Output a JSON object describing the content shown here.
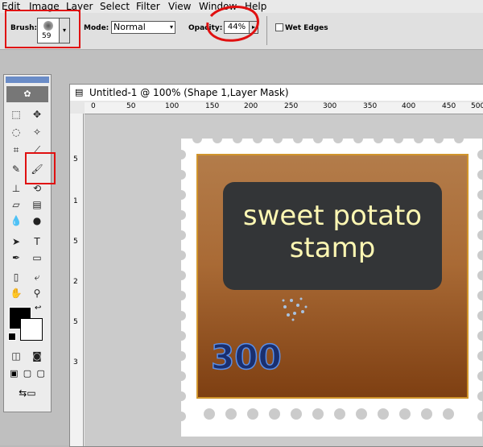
{
  "menu": [
    "Edit",
    "Image",
    "Layer",
    "Select",
    "Filter",
    "View",
    "Window",
    "Help"
  ],
  "options": {
    "brush_label": "Brush:",
    "brush_size": "59",
    "mode_label": "Mode:",
    "mode_value": "Normal",
    "opacity_label": "Opacity:",
    "opacity_value": "44%",
    "wet_edges_label": "Wet Edges"
  },
  "document": {
    "title": "Untitled-1 @ 100% (Shape 1,Layer Mask)",
    "ruler_h": [
      "0",
      "50",
      "100",
      "150",
      "200",
      "250",
      "300",
      "350",
      "400",
      "450",
      "500"
    ],
    "ruler_v": [
      "5",
      "1",
      "5",
      "2",
      "5",
      "3"
    ]
  },
  "stamp": {
    "title_line1": "sweet potato",
    "title_line2": "stamp",
    "price": "300"
  },
  "colors": {
    "annotation": "#e01010",
    "stamp_border": "#d1952c",
    "label_bg": "#333537",
    "label_text": "#fdf7b3",
    "price_fill": "#1a2f6f"
  }
}
